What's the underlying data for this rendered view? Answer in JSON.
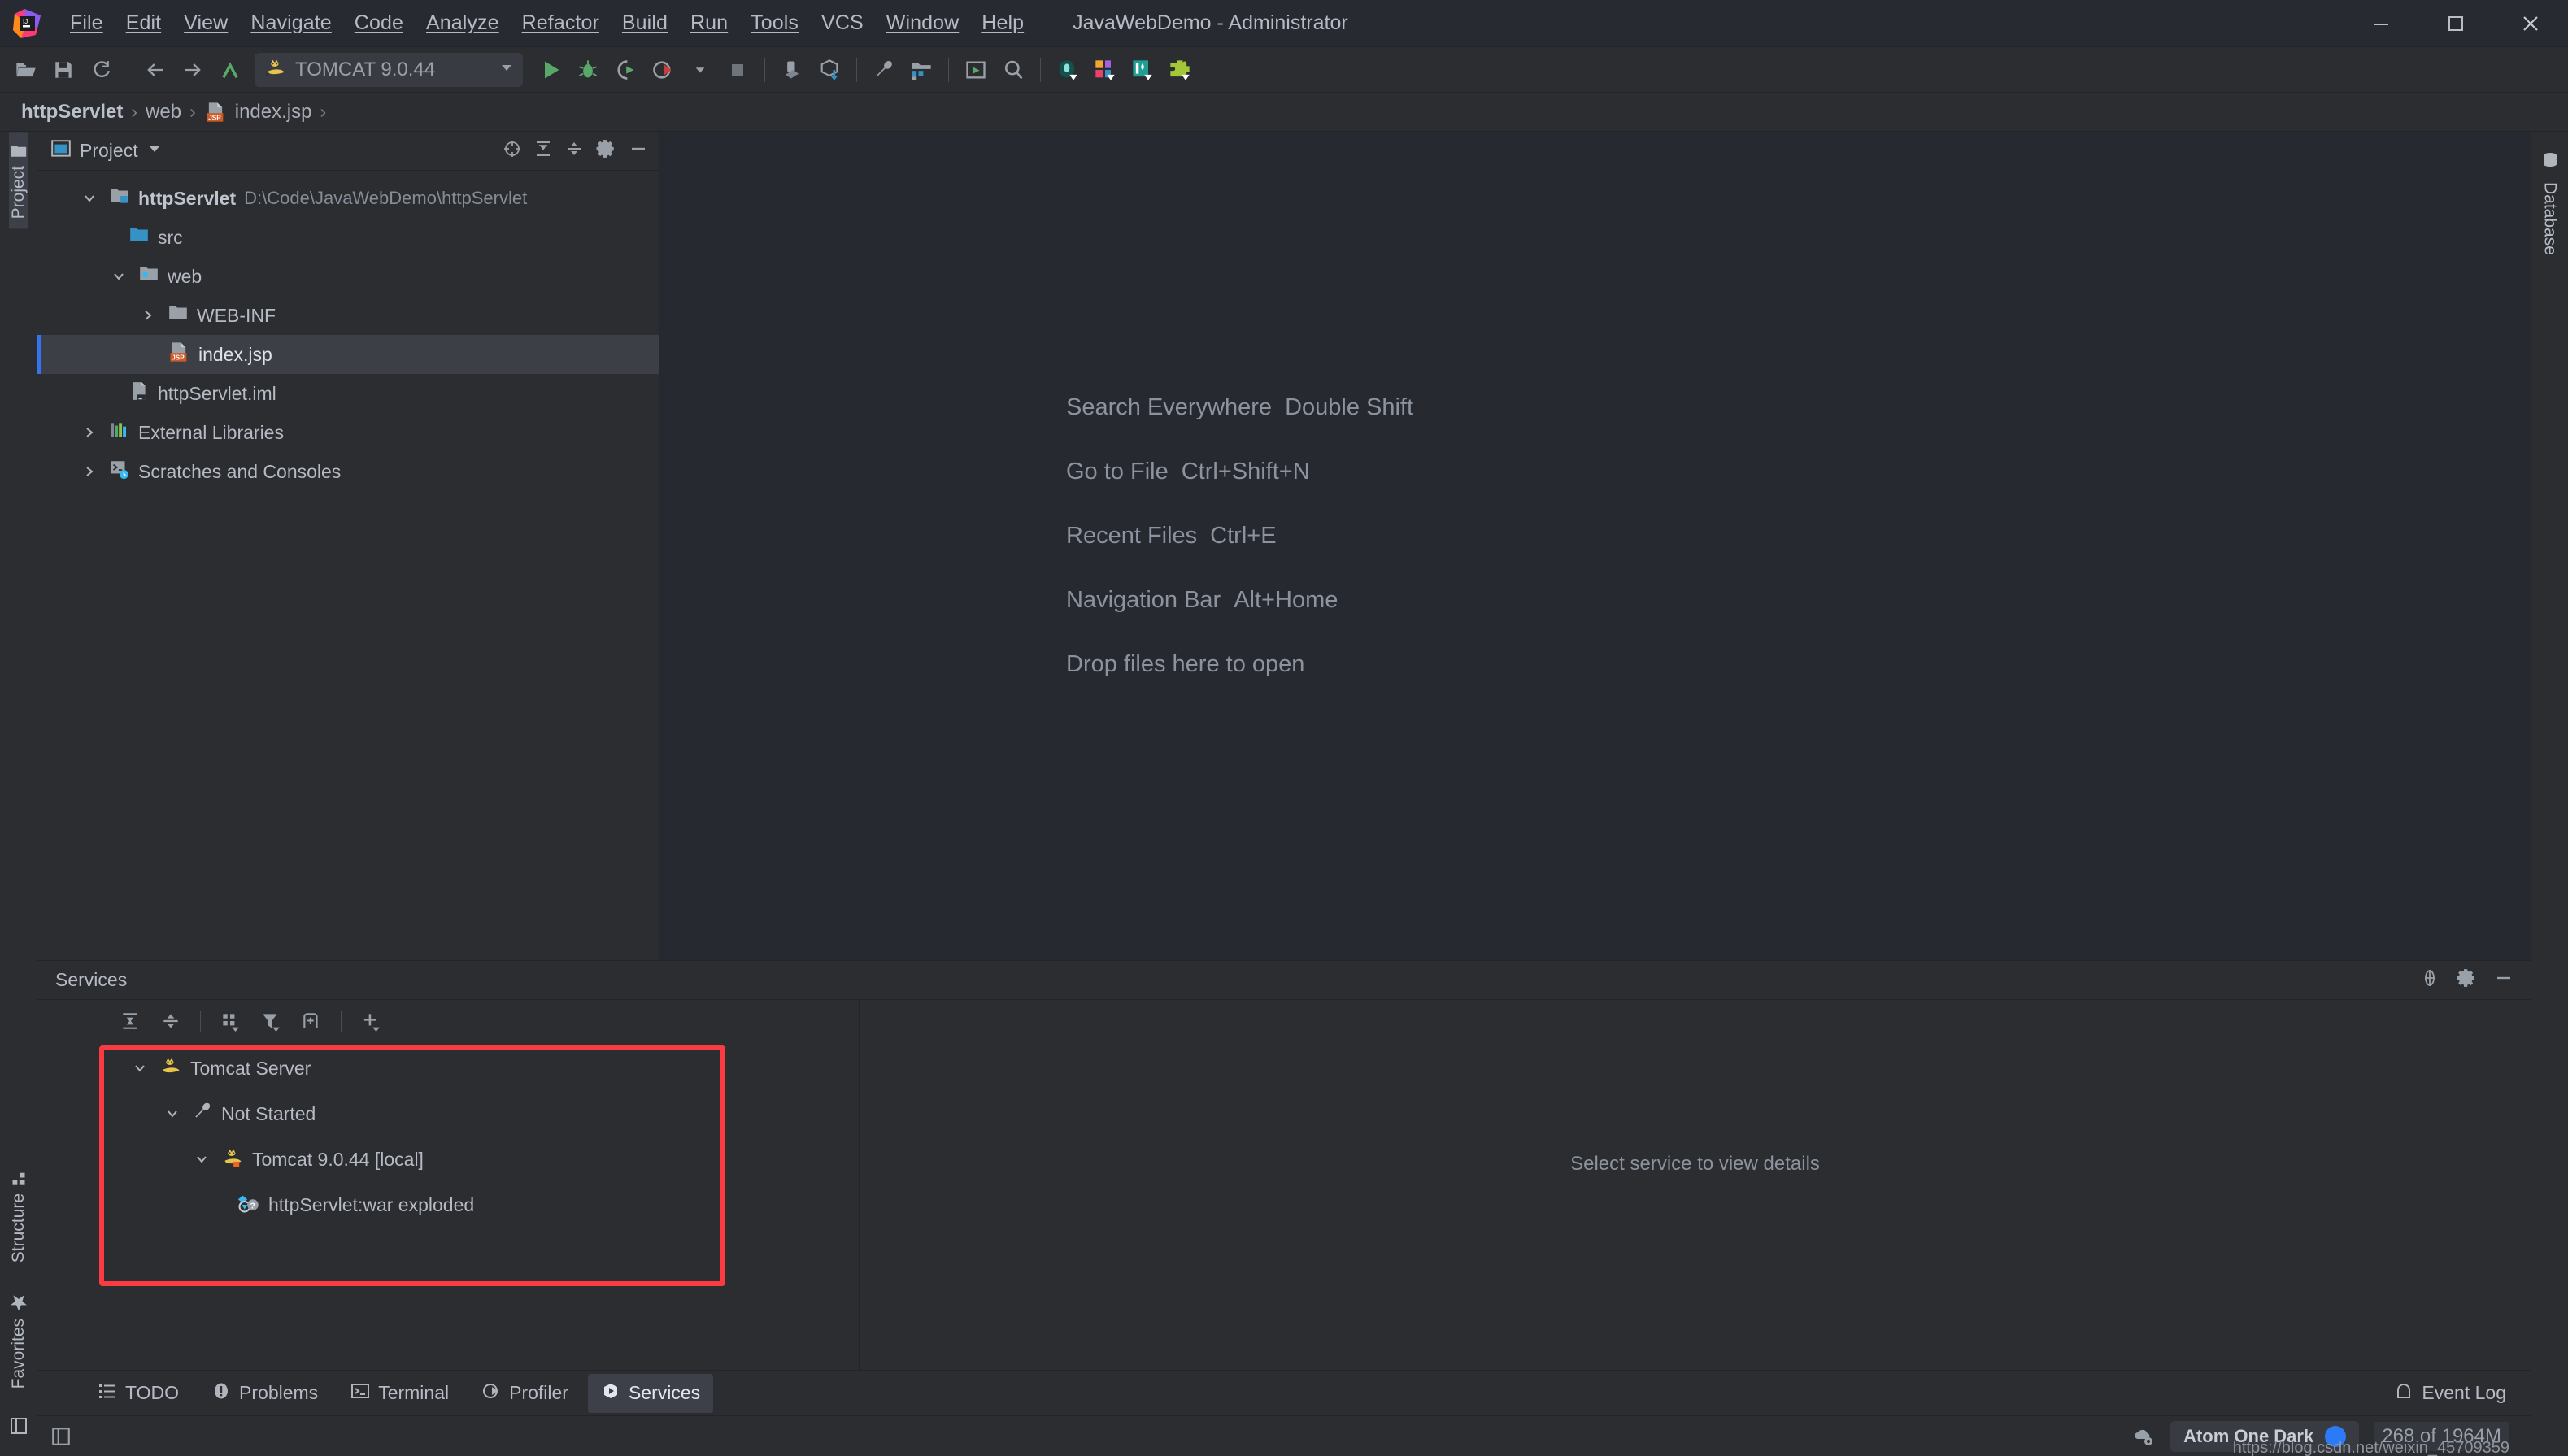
{
  "window": {
    "title": "JavaWebDemo - Administrator",
    "logo_icon": "intellij-idea-logo",
    "minimize_icon": "minimize-icon",
    "maximize_icon": "maximize-icon",
    "close_icon": "close-icon"
  },
  "menu": [
    {
      "label": "File",
      "mnemonic": "F"
    },
    {
      "label": "Edit",
      "mnemonic": "E"
    },
    {
      "label": "View",
      "mnemonic": "V"
    },
    {
      "label": "Navigate",
      "mnemonic": "N"
    },
    {
      "label": "Code",
      "mnemonic": "C"
    },
    {
      "label": "Analyze",
      "mnemonic": "z"
    },
    {
      "label": "Refactor",
      "mnemonic": "R"
    },
    {
      "label": "Build",
      "mnemonic": "B"
    },
    {
      "label": "Run",
      "mnemonic": "u"
    },
    {
      "label": "Tools",
      "mnemonic": "T"
    },
    {
      "label": "VCS",
      "mnemonic": ""
    },
    {
      "label": "Window",
      "mnemonic": "W"
    },
    {
      "label": "Help",
      "mnemonic": "H"
    }
  ],
  "toolbar": {
    "open_icon": "open-folder-icon",
    "save_icon": "save-icon",
    "sync_icon": "refresh-icon",
    "back_icon": "arrow-left-icon",
    "forward_icon": "arrow-right-icon",
    "last_edit_icon": "last-edit-location-icon",
    "run_config": {
      "name": "TOMCAT 9.0.44",
      "icon": "tomcat-cat-icon",
      "dropdown_icon": "chevron-down-icon"
    },
    "run_icon": "run-play-icon",
    "debug_icon": "debug-bug-icon",
    "run_coverage_icon": "run-with-coverage-icon",
    "profile_icon": "profiler-icon",
    "profile_dropdown_icon": "chevron-down-icon",
    "stop_icon": "stop-square-icon",
    "update_app_icon": "update-running-application-icon",
    "import_icon": "import-gradle-icon",
    "settings_icon": "wrench-settings-icon",
    "project_structure_icon": "project-structure-icon",
    "layout_icon": "layout-window-icon",
    "search_icon": "search-icon",
    "plugin1_icon": "codota-plugin-icon",
    "plugin2_icon": "translation-plugin-icon",
    "plugin3_icon": "database-plugin-icon",
    "plugin4_icon": "puzzle-plugin-icon"
  },
  "breadcrumb": {
    "separator": "›",
    "items": [
      {
        "label": "httpServlet",
        "bold": true,
        "icon": ""
      },
      {
        "label": "web",
        "bold": false,
        "icon": ""
      },
      {
        "label": "index.jsp",
        "bold": false,
        "icon": "jsp-file-icon"
      }
    ],
    "trailing_separator": "›"
  },
  "stripes": {
    "left_top": [
      {
        "label": "Project",
        "icon": "project-folder-icon",
        "active": true
      }
    ],
    "left_bottom": [
      {
        "label": "Structure",
        "icon": "structure-icon"
      },
      {
        "label": "Favorites",
        "icon": "star-icon"
      }
    ],
    "left_bottom_toggle_icon": "hide-toolwindows-icon",
    "right_top": [
      {
        "label": "Database",
        "icon": "database-icon"
      }
    ]
  },
  "project_panel": {
    "title": "Project",
    "title_icon": "project-view-icon",
    "title_dropdown_icon": "chevron-down-icon",
    "icons": {
      "locate_icon": "scroll-from-source-icon",
      "expand_icon": "expand-all-icon",
      "collapse_icon": "collapse-all-icon",
      "gear_icon": "gear-icon",
      "hide_icon": "hide-icon"
    },
    "tree": [
      {
        "label": "httpServlet",
        "path": "D:\\Code\\JavaWebDemo\\httpServlet",
        "indent": 0,
        "twisty": "expanded",
        "icon": "module-folder-icon",
        "bold": true,
        "selected": false
      },
      {
        "label": "src",
        "path": "",
        "indent": 1,
        "twisty": "none",
        "icon": "source-folder-icon",
        "bold": false,
        "selected": false
      },
      {
        "label": "web",
        "path": "",
        "indent": 1,
        "twisty": "expanded",
        "icon": "web-folder-icon",
        "bold": false,
        "selected": false
      },
      {
        "label": "WEB-INF",
        "path": "",
        "indent": 2,
        "twisty": "collapsed",
        "icon": "folder-icon",
        "bold": false,
        "selected": false
      },
      {
        "label": "index.jsp",
        "path": "",
        "indent": 2,
        "twisty": "none",
        "icon": "jsp-file-icon",
        "bold": false,
        "selected": true
      },
      {
        "label": "httpServlet.iml",
        "path": "",
        "indent": 1,
        "twisty": "none",
        "icon": "iml-file-icon",
        "bold": false,
        "selected": false
      },
      {
        "label": "External Libraries",
        "path": "",
        "indent": 0,
        "twisty": "collapsed",
        "icon": "libraries-icon",
        "bold": false,
        "selected": false
      },
      {
        "label": "Scratches and Consoles",
        "path": "",
        "indent": 0,
        "twisty": "collapsed",
        "icon": "scratches-icon",
        "bold": false,
        "selected": false
      }
    ]
  },
  "editor": {
    "hints": [
      {
        "action": "Search Everywhere",
        "shortcut": "Double Shift"
      },
      {
        "action": "Go to File",
        "shortcut": "Ctrl+Shift+N"
      },
      {
        "action": "Recent Files",
        "shortcut": "Ctrl+E"
      },
      {
        "action": "Navigation Bar",
        "shortcut": "Alt+Home"
      },
      {
        "action": "Drop files here to open",
        "shortcut": ""
      }
    ]
  },
  "services": {
    "title": "Services",
    "icons": {
      "locate_icon": "scroll-to-source-icon",
      "gear_icon": "gear-icon",
      "hide_icon": "hide-icon"
    },
    "toolbar": {
      "expand_icon": "expand-all-icon",
      "collapse_icon": "collapse-all-icon",
      "group_icon": "group-by-icon",
      "filter_icon": "filter-icon",
      "add_tab_icon": "add-tab-icon",
      "add_icon": "add-service-icon"
    },
    "tree": [
      {
        "label": "Tomcat Server",
        "indent": 0,
        "twisty": "expanded",
        "icon": "tomcat-cat-icon"
      },
      {
        "label": "Not Started",
        "indent": 1,
        "twisty": "expanded",
        "icon": "wrench-icon"
      },
      {
        "label": "Tomcat 9.0.44 [local]",
        "indent": 2,
        "twisty": "expanded",
        "icon": "tomcat-cat-badge-icon"
      },
      {
        "label": "httpServlet:war exploded",
        "indent": 3,
        "twisty": "none",
        "icon": "artifact-unknown-icon"
      }
    ],
    "highlight_color": "#fb3b41",
    "empty_detail": "Select service to view details"
  },
  "bottom_tabs": [
    {
      "label": "TODO",
      "icon": "todo-list-icon",
      "active": false
    },
    {
      "label": "Problems",
      "icon": "problems-icon",
      "active": false
    },
    {
      "label": "Terminal",
      "icon": "terminal-icon",
      "active": false
    },
    {
      "label": "Profiler",
      "icon": "profiler-icon",
      "active": false
    },
    {
      "label": "Services",
      "icon": "services-icon",
      "active": true
    }
  ],
  "event_log": {
    "label": "Event Log",
    "icon": "event-log-icon"
  },
  "statusbar": {
    "toggle_icon": "show-toolwindow-bars-icon",
    "cloud_icon": "cloud-settings-icon",
    "theme": "Atom One Dark",
    "theme_dot_color": "#2a7bf5",
    "memory": "268 of 1964M",
    "watermark": "https://blog.csdn.net/weixin_45709359"
  }
}
